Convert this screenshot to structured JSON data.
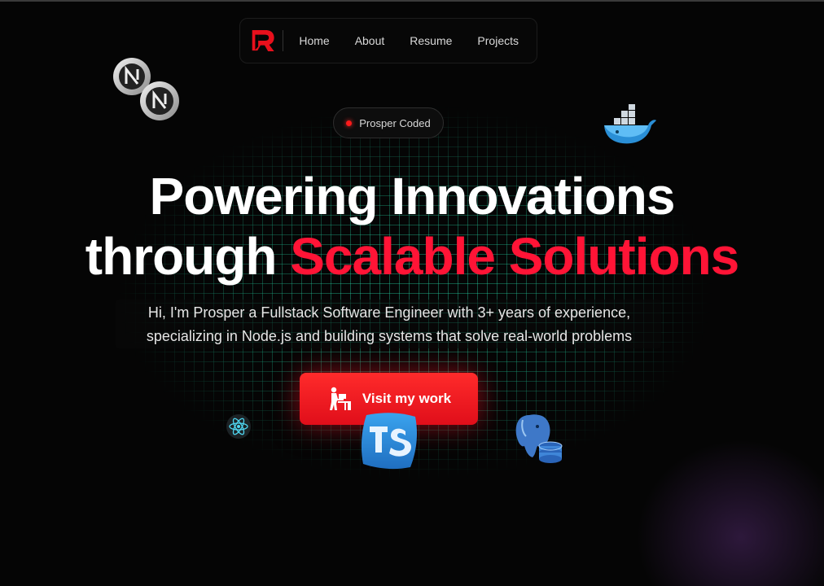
{
  "nav": {
    "links": [
      "Home",
      "About",
      "Resume",
      "Projects"
    ]
  },
  "badge": {
    "text": "Prosper Coded"
  },
  "hero": {
    "title_line1": "Powering Innovations",
    "title_line2_plain": "through ",
    "title_line2_accent": "Scalable Solutions",
    "subtitle_line1": "Hi, I'm Prosper a Fullstack Software Engineer with 3+ years of experience,",
    "subtitle_line2": "specializing in Node.js and building systems that solve real-world problems"
  },
  "cta": {
    "label": "Visit my work",
    "icon": "developer-at-desk-icon"
  },
  "colors": {
    "accent": "#ff1436",
    "button": "#ff2b2b",
    "grid": "#28dcaa",
    "background": "#050505"
  },
  "floating_icons": [
    "nextjs-icon",
    "docker-icon",
    "react-icon",
    "typescript-icon",
    "postgresql-icon"
  ]
}
